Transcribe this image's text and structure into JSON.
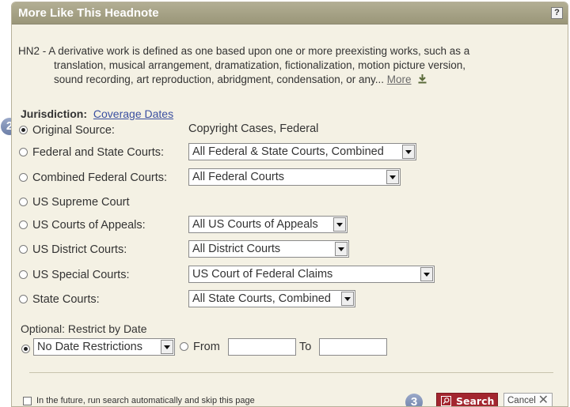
{
  "dialog": {
    "title": "More Like This Headnote",
    "help_label": "?"
  },
  "headnote": {
    "lines": [
      "HN2 - A derivative work is defined as one based upon one or more preexisting works, such as a",
      "translation, musical arrangement, dramatization, fictionalization, motion picture version,",
      "sound recording, art reproduction, abridgment, condensation, or any..."
    ],
    "more_label": "More",
    "download_icon": "download-icon"
  },
  "jurisdiction": {
    "title": "Jurisdiction:",
    "coverage_link": "Coverage Dates",
    "step_badge": "2",
    "rows": [
      {
        "label": "Original Source:",
        "value": "Copyright Cases, Federal",
        "selected": true
      },
      {
        "label": "Federal and State Courts:",
        "value": "All Federal & State Courts, Combined",
        "selected": false
      },
      {
        "label": "Combined Federal Courts:",
        "value": "All Federal Courts",
        "selected": false
      },
      {
        "label": "US Supreme Court",
        "value": "",
        "selected": false
      },
      {
        "label": "US Courts of Appeals:",
        "value": "All US Courts of Appeals",
        "selected": false
      },
      {
        "label": "US District Courts:",
        "value": "All District Courts",
        "selected": false
      },
      {
        "label": "US Special Courts:",
        "value": "US Court of Federal Claims",
        "selected": false
      },
      {
        "label": "State Courts:",
        "value": "All State Courts, Combined",
        "selected": false
      }
    ]
  },
  "date_restriction": {
    "title": "Optional: Restrict by Date",
    "select_value": "No Date Restrictions",
    "from_label": "From",
    "from_value": "",
    "to_label": "To",
    "to_value": ""
  },
  "footer": {
    "auto_run_label": "In the future, run search automatically and skip this page",
    "auto_run_checked": false,
    "step_badge": "3",
    "search_label": "Search",
    "cancel_label": "Cancel"
  },
  "colors": {
    "titlebar": "#a6a288",
    "panel": "#f4f1e4",
    "search_button": "#a3262f",
    "badge": "#7b8cb4",
    "link": "#3a4fa0"
  }
}
